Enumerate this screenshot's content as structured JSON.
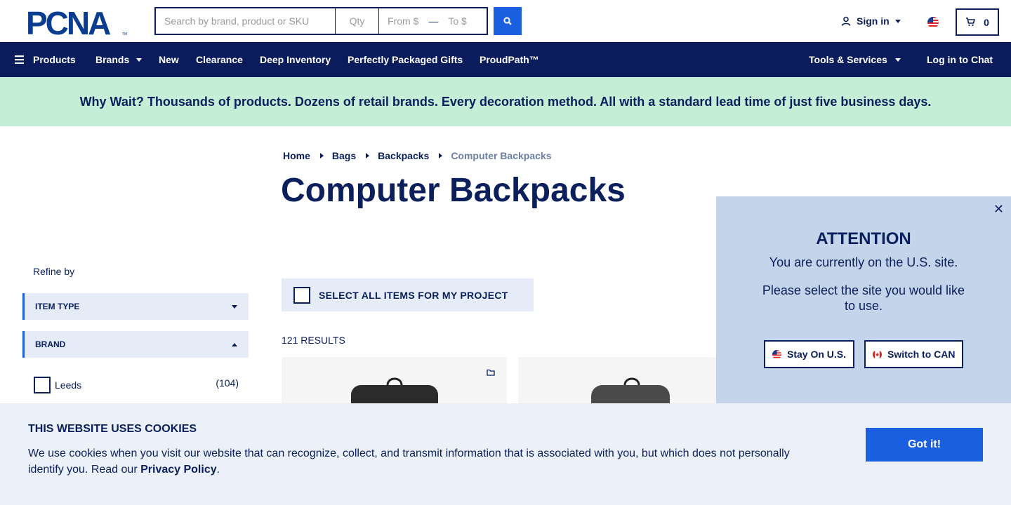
{
  "header": {
    "logo_text": "PCNA",
    "search": {
      "placeholder": "Search by brand, product or SKU",
      "qty_placeholder": "Qty",
      "from_placeholder": "From $",
      "to_placeholder": "To $"
    },
    "sign_in_label": "Sign in",
    "cart_count": "0"
  },
  "nav": {
    "items": [
      {
        "label": "Products",
        "has_menu_icon": true
      },
      {
        "label": "Brands",
        "has_caret": true
      },
      {
        "label": "New"
      },
      {
        "label": "Clearance"
      },
      {
        "label": "Deep Inventory"
      },
      {
        "label": "Perfectly Packaged Gifts"
      },
      {
        "label": "ProudPath™"
      }
    ],
    "right": [
      {
        "label": "Tools & Services",
        "has_caret": true
      },
      {
        "label": "Log in to Chat"
      }
    ]
  },
  "banner": {
    "text": "Why Wait? Thousands of products. Dozens of retail brands. Every decoration method. All with a standard lead time of just five business days."
  },
  "breadcrumb": [
    "Home",
    "Bags",
    "Backpacks",
    "Computer Backpacks"
  ],
  "page_title": "Computer Backpacks",
  "filters": {
    "refine_label": "Refine by",
    "groups": [
      {
        "label": "ITEM TYPE",
        "expanded": false
      },
      {
        "label": "BRAND",
        "expanded": true
      }
    ],
    "brand_options": [
      {
        "label": "Leeds",
        "count": "(104)"
      }
    ]
  },
  "select_all_label": "SELECT ALL ITEMS FOR MY PROJECT",
  "results_label": "121 RESULTS",
  "popup": {
    "close": "✕",
    "title": "ATTENTION",
    "message": "You are currently on the U.S. site.",
    "prompt": "Please select the site you would like to use.",
    "stay_label": "Stay On U.S.",
    "switch_label": "Switch to CAN"
  },
  "cookie": {
    "title": "THIS WEBSITE USES COOKIES",
    "text": "We use cookies when you visit our website that can recognize, collect, and transmit information that is associated with you, but which does not personally identify you. Read our ",
    "link": "Privacy Policy",
    "end": ".",
    "button": "Got it!"
  },
  "colors": {
    "navy": "#0a1c5b",
    "blue": "#1a5fe0",
    "banner_bg": "#c4eed6",
    "popup_bg": "#c3d4eb",
    "cookie_bg": "#ebf0f9"
  }
}
